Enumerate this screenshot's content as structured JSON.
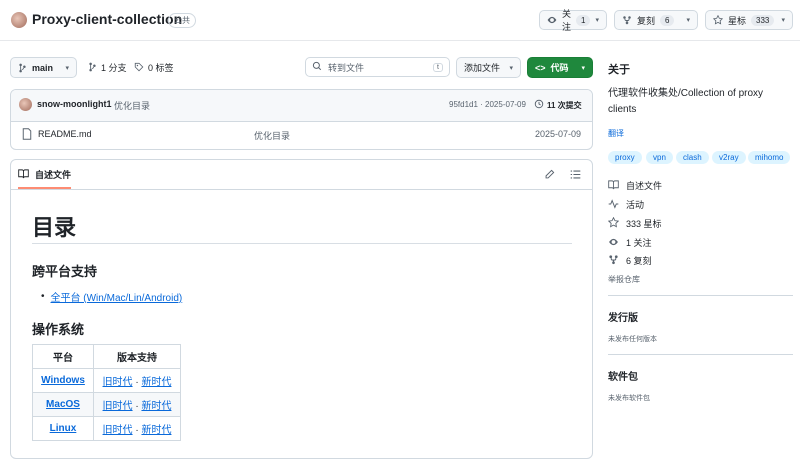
{
  "repo": {
    "name": "Proxy-client-collection",
    "visibility": "公共"
  },
  "header_actions": {
    "watch_label": "关注",
    "watch_count": "1",
    "fork_label": "复刻",
    "fork_count": "6",
    "star_label": "星标",
    "star_count": "333"
  },
  "toolbar": {
    "branch": "main",
    "branches": "1 分支",
    "tags": "0 标签",
    "goto_placeholder": "转到文件",
    "goto_key": "t",
    "add_file": "添加文件",
    "code": "代码"
  },
  "commit_bar": {
    "author": "snow-moonlight1",
    "message": "优化目录",
    "hash_date": "95fd1d1 · 2025-07-09",
    "commits": "11 次提交"
  },
  "files": [
    {
      "name": "README.md",
      "message": "优化目录",
      "date": "2025-07-09"
    }
  ],
  "readme": {
    "tab": "自述文件",
    "h1": "目录",
    "h2_cross": "跨平台支持",
    "cross_link": "全平台 (Win/Mac/Lin/Android)",
    "h2_os": "操作系统",
    "table_headers": [
      "平台",
      "版本支持"
    ],
    "rows": [
      {
        "platform": "Windows",
        "old": "旧时代",
        "dot": "·",
        "new": "新时代"
      },
      {
        "platform": "MacOS",
        "old": "旧时代",
        "dot": "·",
        "new": "新时代"
      },
      {
        "platform": "Linux",
        "old": "旧时代",
        "dot": "·",
        "new": "新时代"
      }
    ]
  },
  "about": {
    "title": "关于",
    "description": "代理软件收集处/Collection of proxy clients",
    "translate": "翻译",
    "topics": [
      "proxy",
      "vpn",
      "clash",
      "v2ray",
      "mihomo"
    ],
    "readme": "自述文件",
    "activity": "活动",
    "stars": "333 星标",
    "watchers": "1 关注",
    "forks": "6 复刻",
    "report": "举报仓库"
  },
  "releases": {
    "title": "发行版",
    "empty": "未发布任何版本"
  },
  "packages": {
    "title": "软件包",
    "empty": "未发布软件包"
  },
  "colors": {
    "accent": "#0969da",
    "code_button": "#1f883d",
    "topic_bg": "#ddf4ff",
    "border": "#d1d9e0"
  }
}
